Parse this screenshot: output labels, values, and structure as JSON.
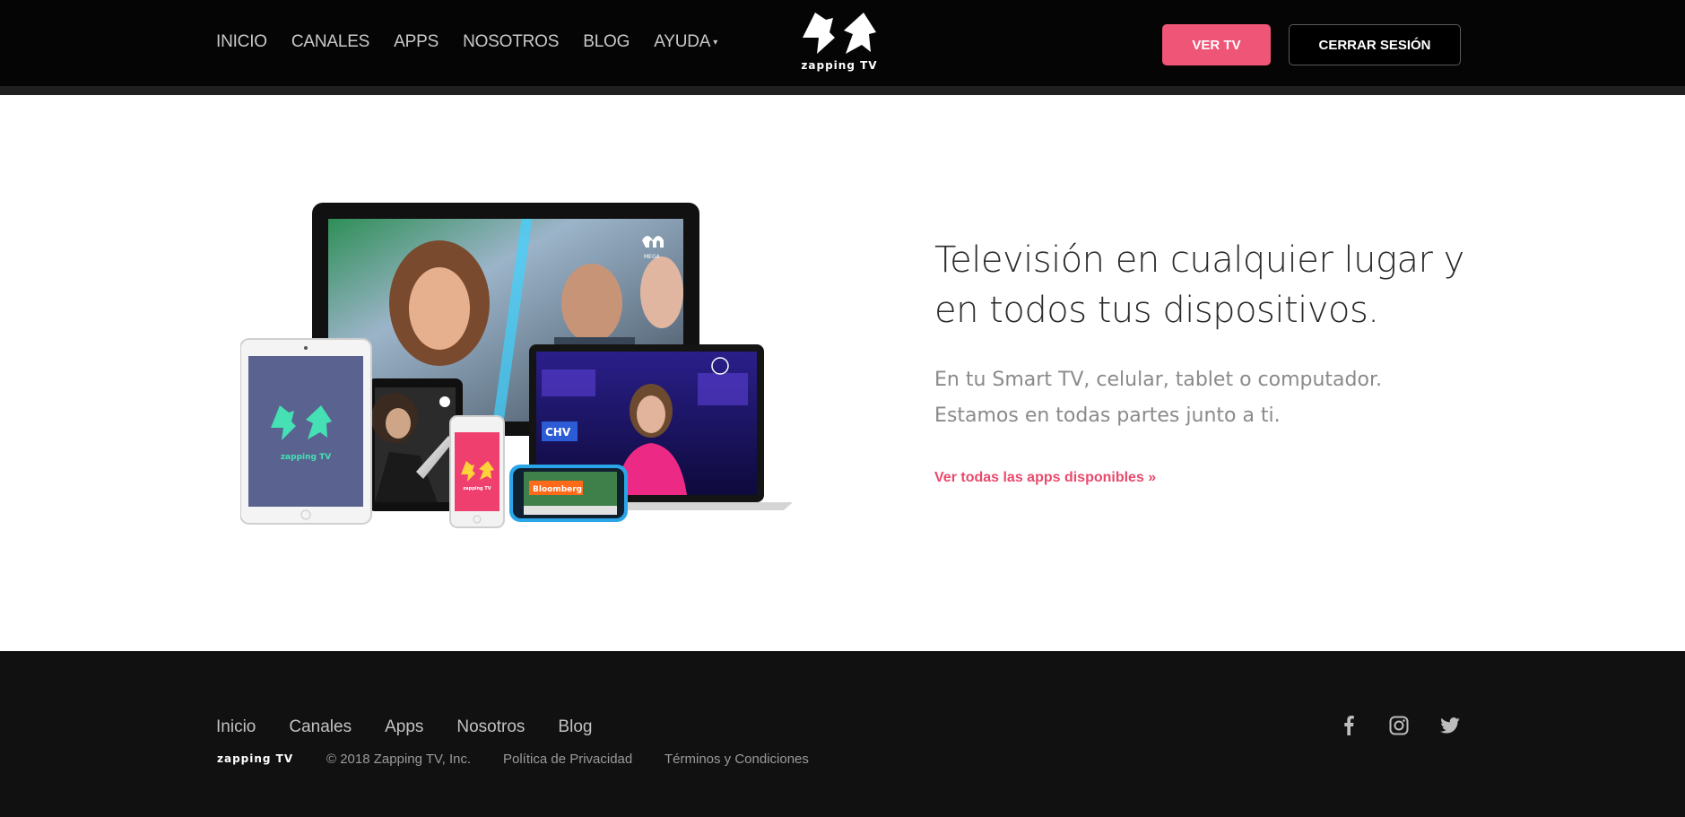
{
  "header": {
    "nav": [
      "INICIO",
      "CANALES",
      "APPS",
      "NOSOTROS",
      "BLOG"
    ],
    "nav_dropdown": "AYUDA",
    "logo_text": "zapping TV",
    "ver_tv_label": "VER TV",
    "logout_label": "CERRAR SESIÓN"
  },
  "hero": {
    "heading": "Televisión en cualquier lugar y en todos tus dispositivos.",
    "subtext": "En tu Smart TV, celular, tablet o computador. Estamos en todas partes junto a ti.",
    "apps_link": "Ver todas las apps disponibles »",
    "device_labels": {
      "tablet_logo": "zapping TV",
      "phone_logo": "zapping TV",
      "mega": "MEGA",
      "chv": "CHV",
      "bloomberg": "Bloomberg"
    }
  },
  "footer": {
    "nav": [
      "Inicio",
      "Canales",
      "Apps",
      "Nosotros",
      "Blog"
    ],
    "logo_text": "zapping TV",
    "copyright": "© 2018 Zapping TV, Inc.",
    "privacy": "Política de Privacidad",
    "terms": "Términos y Condiciones"
  },
  "social": [
    "facebook-icon",
    "instagram-icon",
    "twitter-icon"
  ],
  "colors": {
    "accent": "#ef5576",
    "header_bg": "#050505",
    "footer_bg": "#111111",
    "logo_green": "#45e0b3"
  }
}
